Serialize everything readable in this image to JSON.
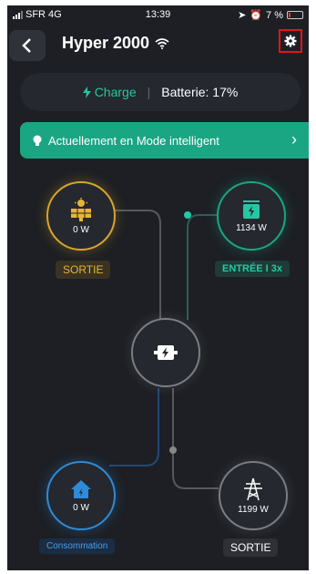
{
  "status_bar": {
    "carrier": "SFR",
    "network": "4G",
    "time": "13:39",
    "battery": "7 %"
  },
  "header": {
    "title": "Hyper 2000"
  },
  "charge_bar": {
    "state": "Charge",
    "battery_label": "Batterie: 17%"
  },
  "mode_banner": {
    "label": "Actuellement en Mode intelligent"
  },
  "nodes": {
    "solar": {
      "value": "0 W",
      "tag": "SORTIE"
    },
    "input": {
      "value": "1134 W",
      "tag": "ENTRÉE I 3x"
    },
    "home": {
      "value": "0 W",
      "tag": "Consommation"
    },
    "grid": {
      "value": "1199 W",
      "tag": "SORTIE"
    }
  },
  "colors": {
    "accent": "#1aa683",
    "solar": "#d6a52b",
    "home": "#2e8bd8",
    "settings_highlight": "#e8131b"
  }
}
